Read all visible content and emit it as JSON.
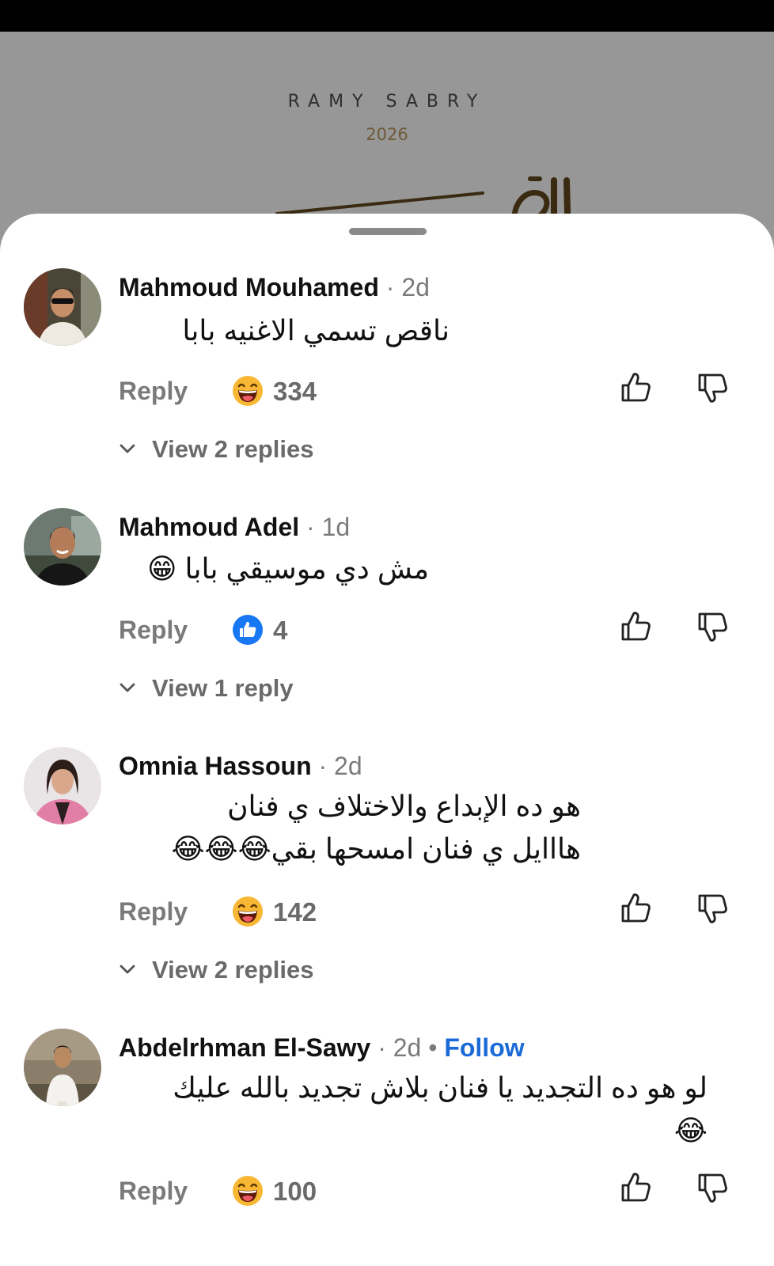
{
  "video": {
    "artist": "RAMY SABRY",
    "year": "2026"
  },
  "colors": {
    "follow": "#1b6ad8",
    "muted_text": "#7a7a7a",
    "like_blue": "#1877f2"
  },
  "comments": [
    {
      "username": "Mahmoud Mouhamed",
      "age": "2d",
      "lines": [
        "ناقص تسمي الاغنيه بابا"
      ],
      "reply_label": "Reply",
      "reaction_icon": "laughing-emoji-icon",
      "reaction_count": "334",
      "view_replies": "View 2 replies"
    },
    {
      "username": "Mahmoud Adel",
      "age": "1d",
      "lines": [
        "مش دي موسيقي بابا 😁"
      ],
      "reply_label": "Reply",
      "reaction_icon": "like-icon",
      "reaction_count": "4",
      "view_replies": "View 1 reply"
    },
    {
      "username": "Omnia Hassoun",
      "age": "2d",
      "lines": [
        "هو ده الإبداع والاختلاف ي فنان",
        "هااايل ي فنان امسحها بقي😂😂😂"
      ],
      "reply_label": "Reply",
      "reaction_icon": "laughing-emoji-icon",
      "reaction_count": "142",
      "view_replies": "View 2 replies"
    },
    {
      "username": "Abdelrhman El-Sawy",
      "age": "2d",
      "follow": "Follow",
      "lines": [
        "لو هو ده التجديد يا فنان بلاش تجديد بالله عليك",
        "😂"
      ],
      "reply_label": "Reply",
      "reaction_icon": "laughing-emoji-icon",
      "reaction_count": "100"
    }
  ]
}
